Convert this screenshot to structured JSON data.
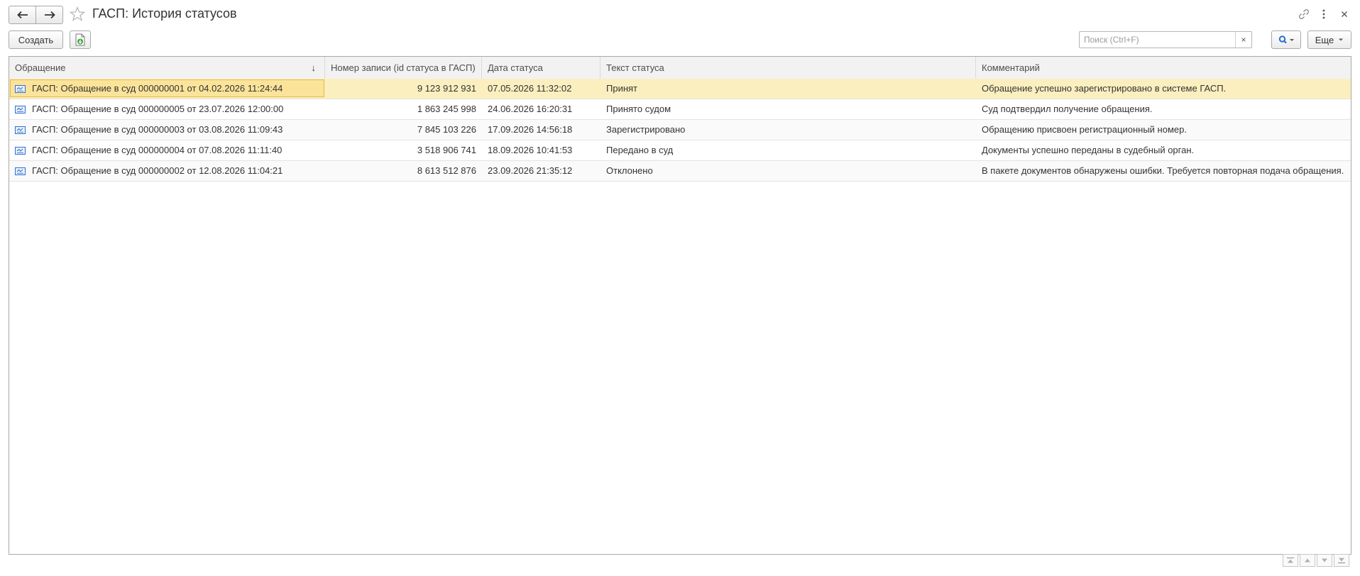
{
  "window": {
    "title": "ГАСП: История статусов"
  },
  "toolbar": {
    "create_label": "Создать",
    "more_label": "Еще"
  },
  "search": {
    "placeholder": "Поиск (Ctrl+F)",
    "value": "",
    "clear_glyph": "×"
  },
  "table": {
    "columns": [
      "Обращение",
      "Номер записи (id статуса в ГАСП)",
      "Дата статуса",
      "Текст статуса",
      "Комментарий"
    ],
    "sort_indicator": "↓",
    "rows": [
      {
        "appeal": "ГАСП: Обращение в суд 000000001 от 04.02.2026 11:24:44",
        "record_id": "9 123 912 931",
        "date": "07.05.2026 11:32:02",
        "status": "Принят",
        "comment": "Обращение успешно зарегистрировано в системе ГАСП."
      },
      {
        "appeal": "ГАСП: Обращение в суд 000000005 от 23.07.2026 12:00:00",
        "record_id": "1 863 245 998",
        "date": "24.06.2026 16:20:31",
        "status": "Принято судом",
        "comment": "Суд подтвердил получение обращения."
      },
      {
        "appeal": "ГАСП: Обращение в суд 000000003 от 03.08.2026 11:09:43",
        "record_id": "7 845 103 226",
        "date": "17.09.2026 14:56:18",
        "status": "Зарегистрировано",
        "comment": "Обращению присвоен регистрационный номер."
      },
      {
        "appeal": "ГАСП: Обращение в суд 000000004 от 07.08.2026 11:11:40",
        "record_id": "3 518 906 741",
        "date": "18.09.2026 10:41:53",
        "status": "Передано в суд",
        "comment": "Документы успешно переданы в судебный орган."
      },
      {
        "appeal": "ГАСП: Обращение в суд 000000002 от 12.08.2026 11:04:21",
        "record_id": "8 613 512 876",
        "date": "23.09.2026 21:35:12",
        "status": "Отклонено",
        "comment": "В пакете документов обнаружены ошибки. Требуется повторная подача обращения."
      }
    ]
  },
  "colors": {
    "selected_row": "#fbefbf",
    "focused_cell": "#fbe49a",
    "header_bg": "#f2f2f2",
    "search_icon": "#2f6fd0",
    "doc_icon": "#2f6fd0"
  },
  "icons": {
    "back": "arrow-left-icon",
    "forward": "arrow-right-icon",
    "favorite": "star-icon",
    "link": "link-icon",
    "menu": "more-vertical-icon",
    "close": "close-icon",
    "save_to_file": "save-document-icon",
    "search": "search-icon",
    "row": "document-icon"
  }
}
